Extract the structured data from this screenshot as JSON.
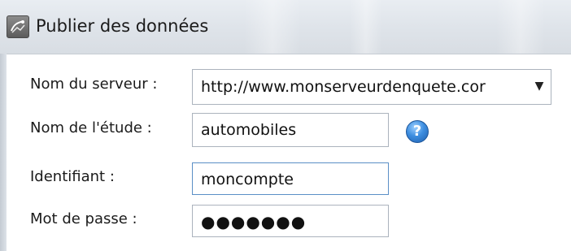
{
  "window": {
    "title": "Publier des données",
    "app_icon": "publish-app-icon"
  },
  "form": {
    "server": {
      "label": "Nom du serveur :",
      "value": "http://www.monserveurdenquete.cor",
      "dropdown_icon": "chevron-down-icon"
    },
    "study": {
      "label": "Nom de l'étude :",
      "value": "automobiles",
      "help_icon": "help-icon",
      "help_glyph": "?"
    },
    "identifier": {
      "label": "Identifiant :",
      "value": "moncompte"
    },
    "password": {
      "label": "Mot de passe :",
      "value": "●●●●●●●"
    }
  }
}
